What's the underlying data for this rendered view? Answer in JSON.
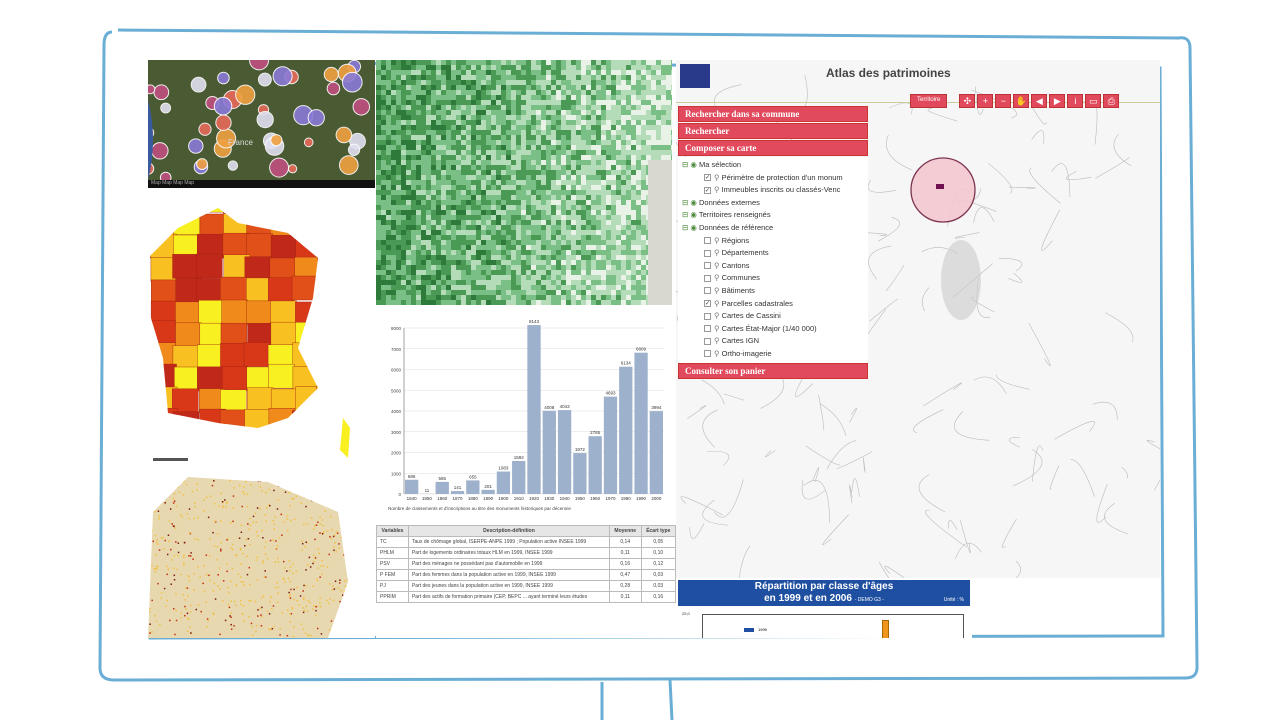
{
  "satellite_map": {
    "label": "France",
    "footer": "Map Map Map Map"
  },
  "atlas": {
    "title": "Atlas des patrimoines",
    "territory_button": "Territoire",
    "toolbar_icons": [
      "zoom-extent-icon",
      "zoom-in-icon",
      "zoom-out-icon",
      "pan-hand-icon",
      "back-icon",
      "forward-icon",
      "info-icon",
      "measure-icon",
      "print-icon"
    ],
    "menu": {
      "search_commune": "Rechercher dans sa commune",
      "search": "Rechercher",
      "compose": "Composer sa carte",
      "basket": "Consulter son panier"
    },
    "tree": [
      {
        "label": "Ma sélection",
        "level": 1,
        "group": true
      },
      {
        "label": "Périmètre de protection d'un monum",
        "level": 2,
        "checked": true
      },
      {
        "label": "Immeubles inscrits ou classés-Venc",
        "level": 2,
        "checked": true
      },
      {
        "label": "Données externes",
        "level": 1,
        "group": true
      },
      {
        "label": "Territoires renseignés",
        "level": 1,
        "group": true
      },
      {
        "label": "Données de référence",
        "level": 1,
        "group": true
      },
      {
        "label": "Régions",
        "level": 2,
        "checked": false
      },
      {
        "label": "Départements",
        "level": 2,
        "checked": false
      },
      {
        "label": "Cantons",
        "level": 2,
        "checked": false
      },
      {
        "label": "Communes",
        "level": 2,
        "checked": false
      },
      {
        "label": "Bâtiments",
        "level": 2,
        "checked": false
      },
      {
        "label": "Parcelles cadastrales",
        "level": 2,
        "checked": true
      },
      {
        "label": "Cartes de Cassini",
        "level": 2,
        "checked": false
      },
      {
        "label": "Cartes État-Major (1/40 000)",
        "level": 2,
        "checked": false
      },
      {
        "label": "Cartes IGN",
        "level": 2,
        "checked": false
      },
      {
        "label": "Ortho-imagerie",
        "level": 2,
        "checked": false
      }
    ]
  },
  "table": {
    "headers": [
      "Variables",
      "Description-définition",
      "Moyenne",
      "Écart type"
    ],
    "rows": [
      [
        "TC",
        "Taux de chômage global, ISERPE-ANPE 1999 ; Population active INSEE 1999",
        "0,14",
        "0,05"
      ],
      [
        "PHLM",
        "Part de logements ordinaires totaux HLM en 1999, INSEE 1999",
        "0,11",
        "0,10"
      ],
      [
        "PSV",
        "Part des ménages ne possédant pas d'automobile en 1999",
        "0,16",
        "0,12"
      ],
      [
        "P FEM",
        "Part des femmes dans la population active en 1999, INSEE 1999",
        "0,47",
        "0,03"
      ],
      [
        "PJ",
        "Part des jeunes dans la population active en 1999, INSEE 1999",
        "0,28",
        "0,03"
      ],
      [
        "PPRIM",
        "Part des actifs de formation primaire (CEP, BEPC ... ayant terminé leurs études",
        "0,11",
        "0,16"
      ]
    ]
  },
  "ages_chart": {
    "title_line1": "Répartition par classe d'âges",
    "title_line2": "en 1999 et en 2006",
    "source": "- DEMO G3 -",
    "unit": "Unité : %",
    "ytick_top": "25,0",
    "legend": "1999"
  },
  "chart_data": {
    "type": "bar",
    "categories": [
      "1840",
      "1850",
      "1860",
      "1870",
      "1880",
      "1890",
      "1900",
      "1910",
      "1920",
      "1930",
      "1940",
      "1950",
      "1960",
      "1970",
      "1980",
      "1990",
      "2000"
    ],
    "values": [
      686,
      11,
      585,
      141,
      655,
      201,
      1083,
      1592,
      8143,
      4008,
      4043,
      1972,
      2785,
      4693,
      6134,
      6809,
      3994
    ],
    "title": "",
    "xlabel": "Nombre de classements et d'inscriptions au titre des monuments historiques par décennie",
    "ylabel": "",
    "ylim": [
      0,
      8000
    ],
    "yticks": [
      "0",
      "1000",
      "2000",
      "3000",
      "4000",
      "5000",
      "6000",
      "7000",
      "8000"
    ],
    "grid": true,
    "color": "#9db1cc"
  },
  "colors": {
    "monitor": "#6aaed6",
    "accent": "#e04a5c",
    "age_header": "#1f4fa0"
  }
}
